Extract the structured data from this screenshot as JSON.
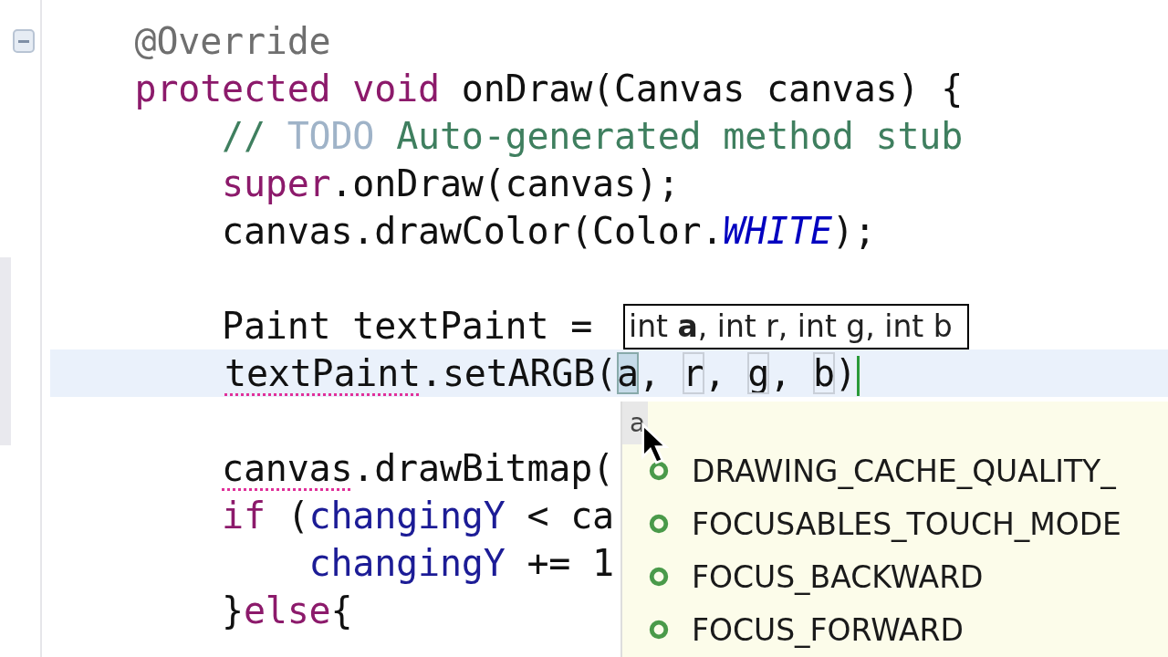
{
  "editor": {
    "lines": [
      {
        "foldable": true,
        "tokens": [
          {
            "text": "    @Override",
            "kind": "annotation"
          }
        ]
      },
      {
        "tokens": [
          {
            "text": "    protected void ",
            "kind": "keyword"
          },
          {
            "text": "onDraw(Canvas canvas) {",
            "kind": "plain"
          }
        ]
      },
      {
        "tokens": [
          {
            "text": "        // ",
            "kind": "comment"
          },
          {
            "text": "TODO",
            "kind": "todo"
          },
          {
            "text": " Auto-generated method stub",
            "kind": "comment"
          }
        ]
      },
      {
        "tokens": [
          {
            "text": "        super",
            "kind": "keyword"
          },
          {
            "text": ".onDraw(canvas);",
            "kind": "plain"
          }
        ]
      },
      {
        "tokens": [
          {
            "text": "        canvas.drawColor(Color.",
            "kind": "plain"
          },
          {
            "text": "WHITE",
            "kind": "static"
          },
          {
            "text": ");",
            "kind": "plain"
          }
        ]
      },
      {
        "kind": "blank"
      },
      {
        "tokens": [
          {
            "text": "        Paint textPaint = ",
            "kind": "plain"
          }
        ]
      },
      {
        "current": true,
        "caret": true,
        "tokens": [
          {
            "text": "        textPaint",
            "kind": "plain",
            "error": true
          },
          {
            "text": ".setARGB(",
            "kind": "plain"
          },
          {
            "text": "a",
            "kind": "param",
            "selected": true
          },
          {
            "text": ", ",
            "kind": "plain"
          },
          {
            "text": "r",
            "kind": "param",
            "selected": false
          },
          {
            "text": ", ",
            "kind": "plain"
          },
          {
            "text": "g",
            "kind": "param",
            "selected": false
          },
          {
            "text": ", ",
            "kind": "plain"
          },
          {
            "text": "b",
            "kind": "param",
            "selected": false
          },
          {
            "text": ")",
            "kind": "plain"
          }
        ]
      },
      {
        "kind": "blank"
      },
      {
        "tokens": [
          {
            "text": "        canvas",
            "kind": "plain",
            "error": true
          },
          {
            "text": ".drawBitmap(",
            "kind": "plain"
          }
        ]
      },
      {
        "tokens": [
          {
            "text": "        if",
            "kind": "keyword"
          },
          {
            "text": " (",
            "kind": "plain"
          },
          {
            "text": "changingY",
            "kind": "field"
          },
          {
            "text": " < ca",
            "kind": "plain"
          }
        ]
      },
      {
        "tokens": [
          {
            "text": "            changingY",
            "kind": "field"
          },
          {
            "text": " += 1",
            "kind": "plain"
          }
        ]
      },
      {
        "tokens": [
          {
            "text": "        }",
            "kind": "plain"
          },
          {
            "text": "else",
            "kind": "keyword"
          },
          {
            "text": "{",
            "kind": "plain"
          }
        ]
      }
    ]
  },
  "parameter_hint": {
    "text": "int **a**, int r, int g, int b"
  },
  "completion_popup": {
    "filter": "a",
    "items": [
      {
        "label": "DRAWING_CACHE_QUALITY_",
        "kind": "field"
      },
      {
        "label": "FOCUSABLES_TOUCH_MODE",
        "kind": "field"
      },
      {
        "label": "FOCUS_BACKWARD",
        "kind": "field"
      },
      {
        "label": "FOCUS_FORWARD",
        "kind": "field"
      }
    ]
  }
}
